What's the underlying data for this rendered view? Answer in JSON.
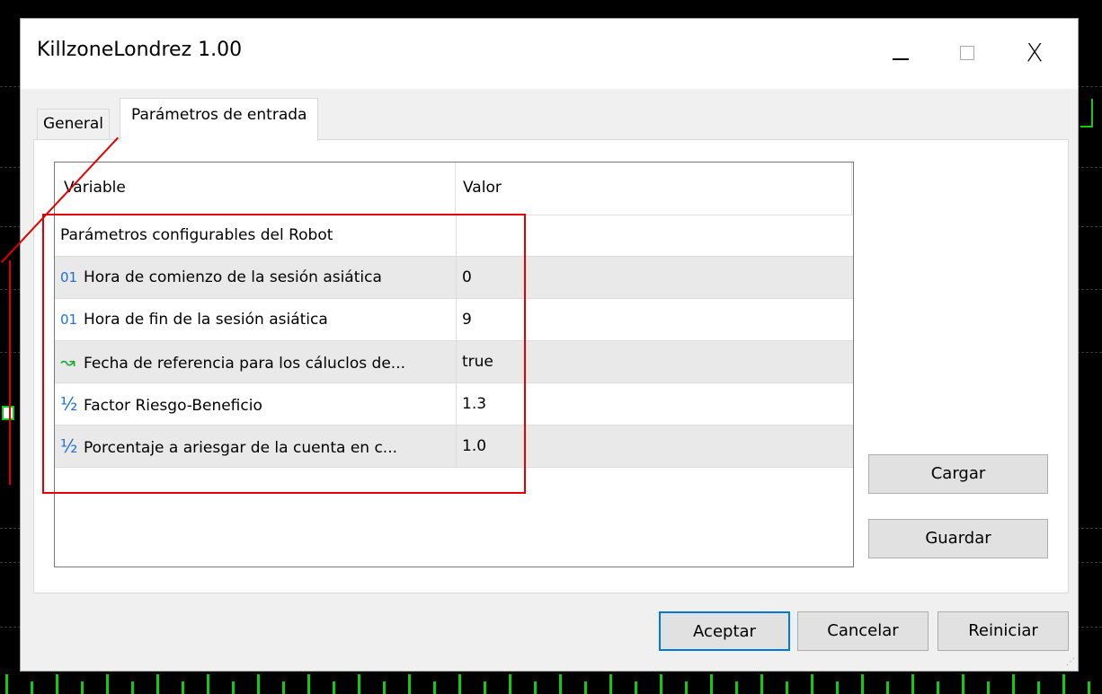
{
  "window": {
    "title": "KillzoneLondrez 1.00",
    "controls": {
      "minimize": "minimize",
      "maximize": "maximize",
      "close": "X"
    }
  },
  "tabs": [
    {
      "label": "General",
      "active": false
    },
    {
      "label": "Parámetros de entrada",
      "active": true
    }
  ],
  "table": {
    "headers": {
      "variable": "Variable",
      "value": "Valor"
    },
    "rows": [
      {
        "icon": "",
        "variable": "Parámetros configurables del Robot",
        "value": ""
      },
      {
        "icon": "integer-icon",
        "variable": "Hora de comienzo de la sesión asiática",
        "value": "0"
      },
      {
        "icon": "integer-icon",
        "variable": "Hora de fin de la sesión asiática",
        "value": "9"
      },
      {
        "icon": "bool-icon",
        "variable": "Fecha de referencia para los cáluclos de...",
        "value": "true"
      },
      {
        "icon": "double-icon",
        "variable": "Factor Riesgo-Beneficio",
        "value": "1.3"
      },
      {
        "icon": "double-icon",
        "variable": "Porcentaje a ariesgar de la cuenta en c...",
        "value": "1.0"
      }
    ]
  },
  "icons": {
    "integer": "01",
    "bool": "↝",
    "double": "½"
  },
  "buttons": {
    "load": "Cargar",
    "save": "Guardar",
    "ok": "Aceptar",
    "cancel": "Cancelar",
    "reset": "Reiniciar"
  },
  "colors": {
    "annotation": "#e00000",
    "accent": "#0078d7",
    "chart_green": "#17c917"
  }
}
